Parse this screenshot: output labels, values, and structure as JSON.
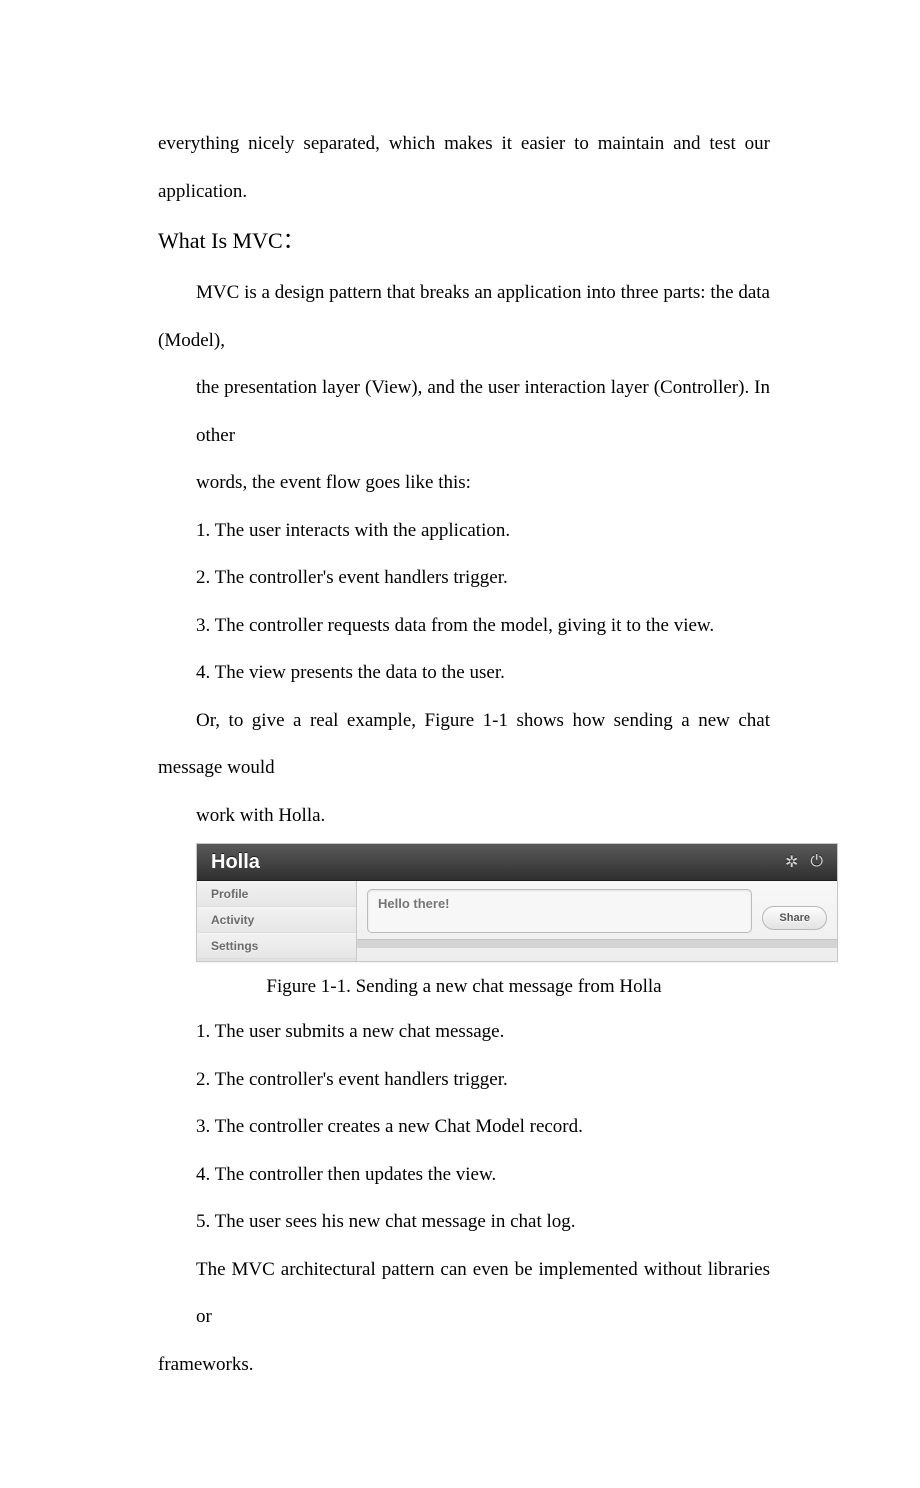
{
  "intro_para": "everything nicely separated, which makes it easier to maintain and test our application.",
  "heading": "What Is MVC：",
  "mvc_intro_1": "MVC is a design pattern that breaks an application into three parts: the data (Model),",
  "mvc_intro_2": "the presentation layer (View), and the user interaction layer (Controller). In other",
  "mvc_intro_3": "words, the event flow goes like this:",
  "flow_steps": [
    "1. The user interacts with the application.",
    "2. The controller's event handlers trigger.",
    "3. The controller requests data from the model, giving it to the view.",
    "4. The view presents the data to the user."
  ],
  "example_lead_1": "Or, to give a real example, Figure 1-1 shows how sending a new chat message would",
  "example_lead_2": "work with Holla.",
  "figure": {
    "app_title": "Holla",
    "sidebar": {
      "items": [
        "Profile",
        "Activity",
        "Settings"
      ]
    },
    "compose": {
      "placeholder": "Hello there!",
      "share_label": "Share"
    }
  },
  "caption": "Figure 1-1. Sending a new chat message from Holla",
  "holla_steps": [
    "1. The user submits a new chat message.",
    "2. The controller's event handlers trigger.",
    "3. The controller creates a new Chat Model record.",
    "4. The controller then updates the view.",
    "5. The user sees his new chat message in chat log."
  ],
  "closing_1": "The MVC architectural pattern can even be implemented without libraries or",
  "closing_2": "frameworks."
}
